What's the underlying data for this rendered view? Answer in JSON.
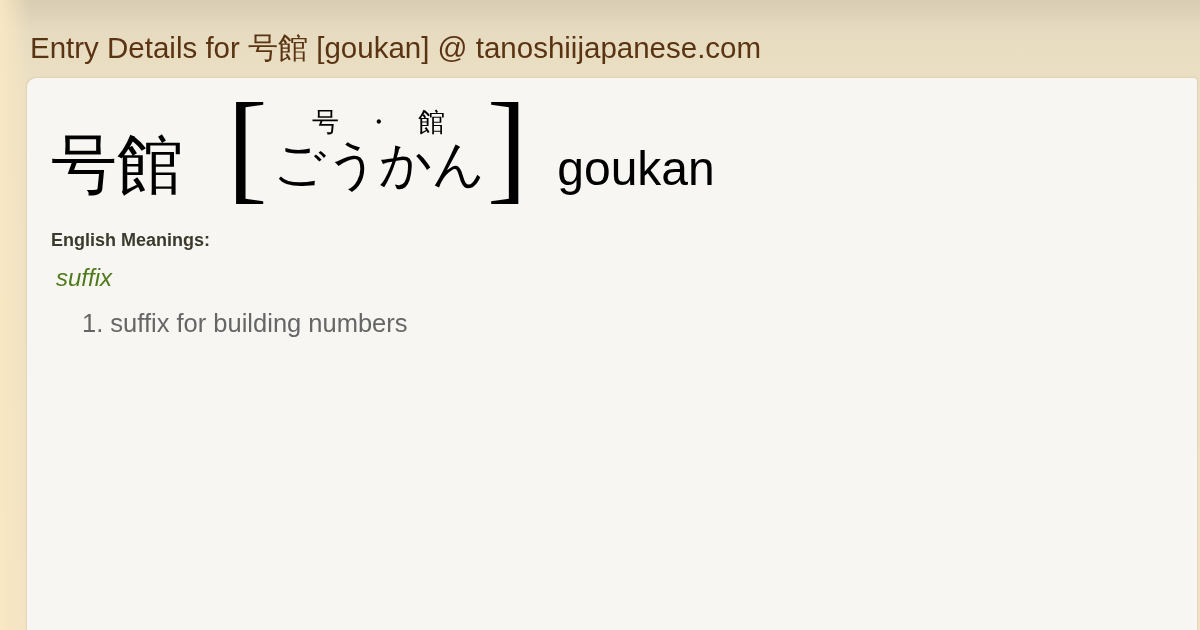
{
  "page_title": "Entry Details for 号館 [goukan] @ tanoshiijapanese.com",
  "entry": {
    "word": "号館",
    "open_bracket": "[",
    "reading": [
      {
        "ruby": "号",
        "kana": "ごう"
      },
      {
        "ruby": "館",
        "kana": "かん"
      }
    ],
    "ruby_separator": "・",
    "close_bracket": "]",
    "romaji": "goukan"
  },
  "meanings": {
    "heading": "English Meanings:",
    "groups": [
      {
        "part_of_speech": "suffix",
        "senses": [
          "1. suffix for building numbers"
        ]
      }
    ]
  }
}
